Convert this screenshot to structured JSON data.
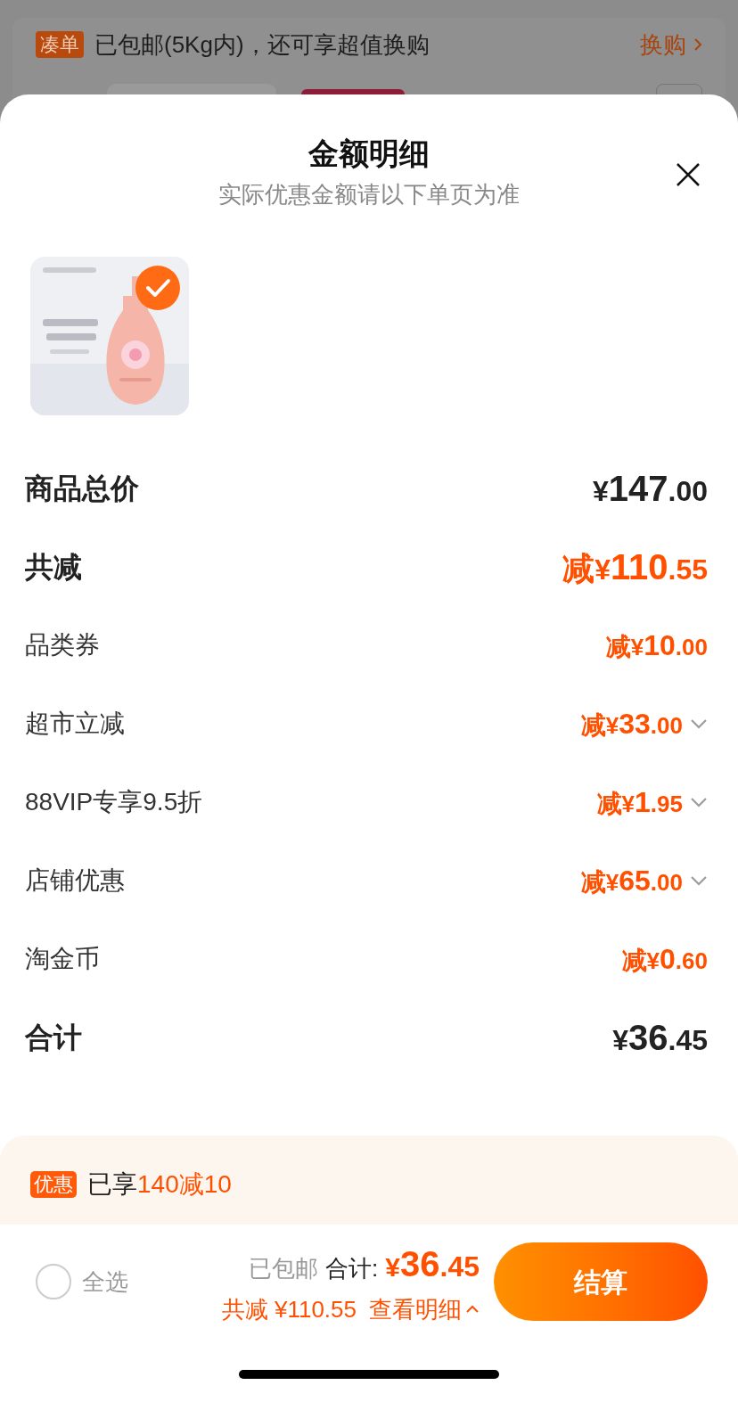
{
  "background": {
    "notice": {
      "tag": "凑单",
      "text": "已包邮(5Kg内)，还可享超值换购",
      "link": "换购"
    }
  },
  "sheet": {
    "title": "金额明细",
    "subtitle": "实际优惠金额请以下单页为准",
    "product": {
      "selected": true
    },
    "rows": [
      {
        "kind": "major",
        "label": "商品总价",
        "prefix": "",
        "currency": "¥",
        "whole": "147",
        "fraction": ".00",
        "discount": false,
        "expandable": false
      },
      {
        "kind": "major",
        "label": "共减",
        "prefix": "减",
        "currency": "¥",
        "whole": "110",
        "fraction": ".55",
        "discount": true,
        "expandable": false
      },
      {
        "kind": "minor",
        "label": "品类券",
        "prefix": "减",
        "currency": "¥",
        "whole": "10",
        "fraction": ".00",
        "discount": true,
        "expandable": false
      },
      {
        "kind": "minor",
        "label": "超市立减",
        "prefix": "减",
        "currency": "¥",
        "whole": "33",
        "fraction": ".00",
        "discount": true,
        "expandable": true
      },
      {
        "kind": "minor",
        "label": "88VIP专享9.5折",
        "prefix": "减",
        "currency": "¥",
        "whole": "1",
        "fraction": ".95",
        "discount": true,
        "expandable": true
      },
      {
        "kind": "minor",
        "label": "店铺优惠",
        "prefix": "减",
        "currency": "¥",
        "whole": "65",
        "fraction": ".00",
        "discount": true,
        "expandable": true
      },
      {
        "kind": "minor",
        "label": "淘金币",
        "prefix": "减",
        "currency": "¥",
        "whole": "0",
        "fraction": ".60",
        "discount": true,
        "expandable": false
      },
      {
        "kind": "major",
        "label": "合计",
        "prefix": "",
        "currency": "¥",
        "whole": "36",
        "fraction": ".45",
        "discount": false,
        "expandable": false
      }
    ],
    "promo": {
      "tag": "优惠",
      "text": "已享",
      "highlight": "140减10"
    }
  },
  "footer": {
    "select_all": {
      "label": "全选",
      "checked": false
    },
    "shipping": "已包邮",
    "total_label": "合计:",
    "total_currency": "¥",
    "total_whole": "36",
    "total_fraction": ".45",
    "saved": "共减 ¥110.55",
    "details": "查看明细",
    "checkout": "结算"
  }
}
